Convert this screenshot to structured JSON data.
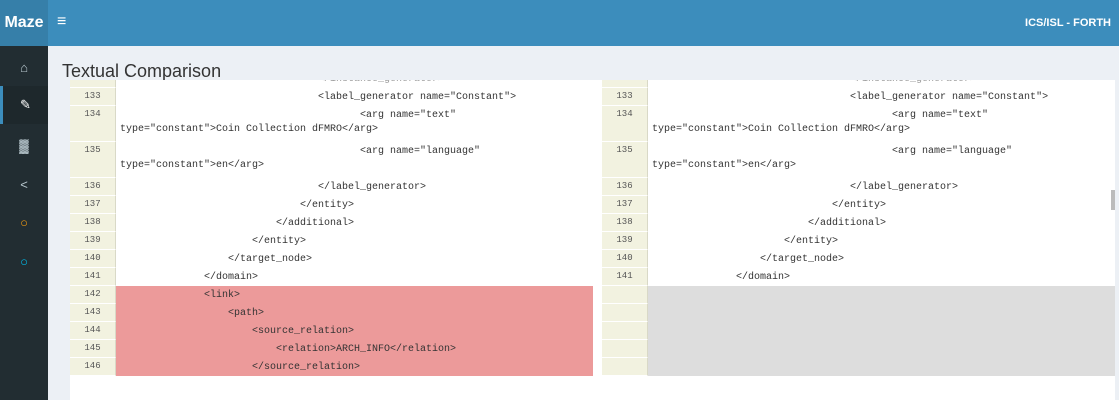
{
  "app": {
    "brand": "Maze",
    "menu_icon": "≡",
    "org": "ICS/ISL - FORTH"
  },
  "sidebar": {
    "items": [
      {
        "icon": "home-icon",
        "glyph": "⌂",
        "color": "#b8c7ce",
        "active": false
      },
      {
        "icon": "pencil-icon",
        "glyph": "✎",
        "color": "#ffffff",
        "active": true
      },
      {
        "icon": "bar-chart-icon",
        "glyph": "▓",
        "color": "#b8c7ce",
        "active": false
      },
      {
        "icon": "share-icon",
        "glyph": "<",
        "color": "#b8c7ce",
        "active": false
      },
      {
        "icon": "circle-orange-icon",
        "glyph": "○",
        "color": "#f39c12",
        "active": false
      },
      {
        "icon": "circle-blue-icon",
        "glyph": "○",
        "color": "#00c0ef",
        "active": false
      }
    ]
  },
  "page": {
    "title": "Textual Comparison"
  },
  "diff": {
    "left": [
      {
        "ln": "",
        "text": "                                 </instance_generator>",
        "kind": "ctx",
        "h": "h0"
      },
      {
        "ln": "133",
        "text": "                                 <label_generator name=\"Constant\">",
        "kind": "ctx",
        "h": "h1"
      },
      {
        "ln": "134",
        "text": "                                        <arg name=\"text\"\ntype=\"constant\">Coin Collection dFMRO</arg>",
        "kind": "ctx",
        "h": "h2"
      },
      {
        "ln": "135",
        "text": "                                        <arg name=\"language\"\ntype=\"constant\">en</arg>",
        "kind": "ctx",
        "h": "h2"
      },
      {
        "ln": "136",
        "text": "                                 </label_generator>",
        "kind": "ctx",
        "h": "h1"
      },
      {
        "ln": "137",
        "text": "                              </entity>",
        "kind": "ctx",
        "h": "h1"
      },
      {
        "ln": "138",
        "text": "                          </additional>",
        "kind": "ctx",
        "h": "h1"
      },
      {
        "ln": "139",
        "text": "                      </entity>",
        "kind": "ctx",
        "h": "h1"
      },
      {
        "ln": "140",
        "text": "                  </target_node>",
        "kind": "ctx",
        "h": "h1"
      },
      {
        "ln": "141",
        "text": "              </domain>",
        "kind": "ctx",
        "h": "h1"
      },
      {
        "ln": "142",
        "text": "              <link>",
        "kind": "added",
        "h": "h1"
      },
      {
        "ln": "143",
        "text": "                  <path>",
        "kind": "added",
        "h": "h1"
      },
      {
        "ln": "144",
        "text": "                      <source_relation>",
        "kind": "added",
        "h": "h1"
      },
      {
        "ln": "145",
        "text": "                          <relation>ARCH_INFO</relation>",
        "kind": "added",
        "h": "h1"
      },
      {
        "ln": "146",
        "text": "                      </source_relation>",
        "kind": "added",
        "h": "h1"
      }
    ],
    "right": [
      {
        "ln": "",
        "text": "                                 </instance_generator>",
        "kind": "ctx",
        "h": "h0"
      },
      {
        "ln": "133",
        "text": "                                 <label_generator name=\"Constant\">",
        "kind": "ctx",
        "h": "h1"
      },
      {
        "ln": "134",
        "text": "                                        <arg name=\"text\"\ntype=\"constant\">Coin Collection dFMRO</arg>",
        "kind": "ctx",
        "h": "h2"
      },
      {
        "ln": "135",
        "text": "                                        <arg name=\"language\"\ntype=\"constant\">en</arg>",
        "kind": "ctx",
        "h": "h2"
      },
      {
        "ln": "136",
        "text": "                                 </label_generator>",
        "kind": "ctx",
        "h": "h1"
      },
      {
        "ln": "137",
        "text": "                              </entity>",
        "kind": "ctx",
        "h": "h1"
      },
      {
        "ln": "138",
        "text": "                          </additional>",
        "kind": "ctx",
        "h": "h1"
      },
      {
        "ln": "139",
        "text": "                      </entity>",
        "kind": "ctx",
        "h": "h1"
      },
      {
        "ln": "140",
        "text": "                  </target_node>",
        "kind": "ctx",
        "h": "h1"
      },
      {
        "ln": "141",
        "text": "              </domain>",
        "kind": "ctx",
        "h": "h1"
      },
      {
        "ln": "",
        "text": "",
        "kind": "empty",
        "h": "h1"
      },
      {
        "ln": "",
        "text": "",
        "kind": "empty",
        "h": "h1"
      },
      {
        "ln": "",
        "text": "",
        "kind": "empty",
        "h": "h1"
      },
      {
        "ln": "",
        "text": "",
        "kind": "empty",
        "h": "h1"
      },
      {
        "ln": "",
        "text": "",
        "kind": "empty",
        "h": "h1"
      }
    ]
  }
}
